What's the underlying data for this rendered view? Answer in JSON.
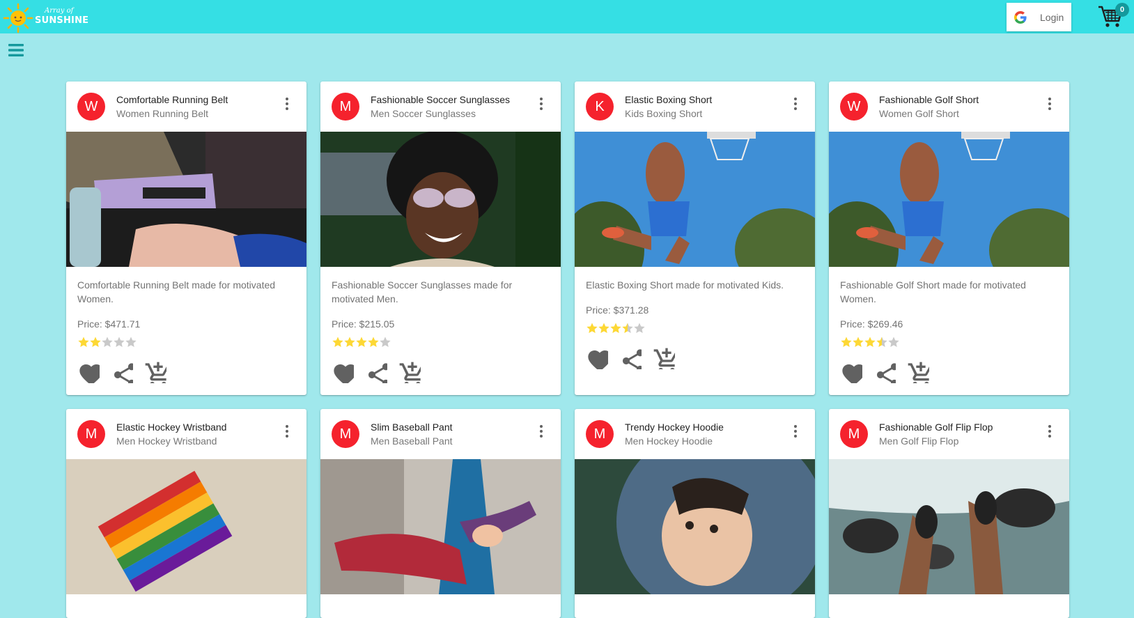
{
  "app": {
    "logo_script": "Array of",
    "logo_brand": "SUNSHINE",
    "login_label": "Login",
    "cart_count": "0"
  },
  "cards": [
    {
      "avatar": "W",
      "title": "Comfortable Running Belt",
      "subtitle": "Women Running Belt",
      "description": "Comfortable Running Belt made for motivated Women.",
      "price": "Price: $471.71",
      "rating": 2
    },
    {
      "avatar": "M",
      "title": "Fashionable Soccer Sunglasses",
      "subtitle": "Men Soccer Sunglasses",
      "description": "Fashionable Soccer Sunglasses made for motivated Men.",
      "price": "Price: $215.05",
      "rating": 4
    },
    {
      "avatar": "K",
      "title": "Elastic Boxing Short",
      "subtitle": "Kids Boxing Short",
      "description": "Elastic Boxing Short made for motivated Kids.",
      "price": "Price: $371.28",
      "rating": 3.5
    },
    {
      "avatar": "W",
      "title": "Fashionable Golf Short",
      "subtitle": "Women Golf Short",
      "description": "Fashionable Golf Short made for motivated Women.",
      "price": "Price: $269.46",
      "rating": 3.5
    },
    {
      "avatar": "M",
      "title": "Elastic Hockey Wristband",
      "subtitle": "Men Hockey Wristband"
    },
    {
      "avatar": "M",
      "title": "Slim Baseball Pant",
      "subtitle": "Men Baseball Pant"
    },
    {
      "avatar": "M",
      "title": "Trendy Hockey Hoodie",
      "subtitle": "Men Hockey Hoodie"
    },
    {
      "avatar": "M",
      "title": "Fashionable Golf Flip Flop",
      "subtitle": "Men Golf Flip Flop"
    }
  ],
  "colors": {
    "appbar": "#35dfe4",
    "background": "#a0e8ec",
    "avatar": "#f5222d",
    "star": "#fdd835"
  }
}
